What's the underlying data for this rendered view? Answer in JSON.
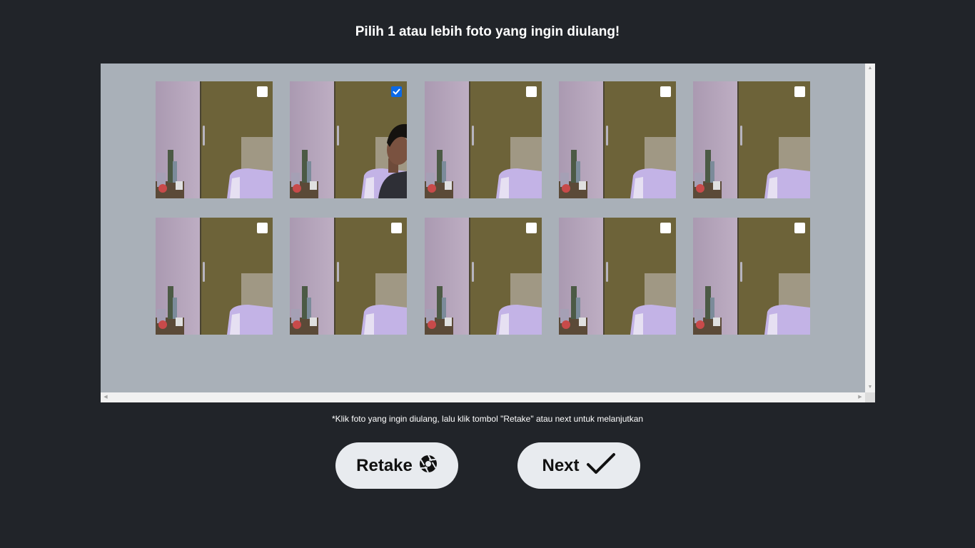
{
  "title": "Pilih 1 atau lebih foto yang ingin diulang!",
  "gallery": {
    "photos": [
      {
        "selected": false,
        "has_person": false
      },
      {
        "selected": true,
        "has_person": true
      },
      {
        "selected": false,
        "has_person": false
      },
      {
        "selected": false,
        "has_person": false
      },
      {
        "selected": false,
        "has_person": false
      },
      {
        "selected": false,
        "has_person": false
      },
      {
        "selected": false,
        "has_person": false
      },
      {
        "selected": false,
        "has_person": false
      },
      {
        "selected": false,
        "has_person": false
      },
      {
        "selected": false,
        "has_person": false
      }
    ]
  },
  "hint": "*Klik foto yang ingin diulang, lalu klik tombol \"Retake\" atau next untuk melanjutkan",
  "buttons": {
    "retake": {
      "label": "Retake",
      "icon": "camera-aperture-icon"
    },
    "next": {
      "label": "Next",
      "icon": "checkmark-icon"
    }
  },
  "colors": {
    "background": "#212429",
    "panel": "#a9b0b8",
    "button": "#e8ebef",
    "checkbox_checked": "#0b69e6"
  }
}
